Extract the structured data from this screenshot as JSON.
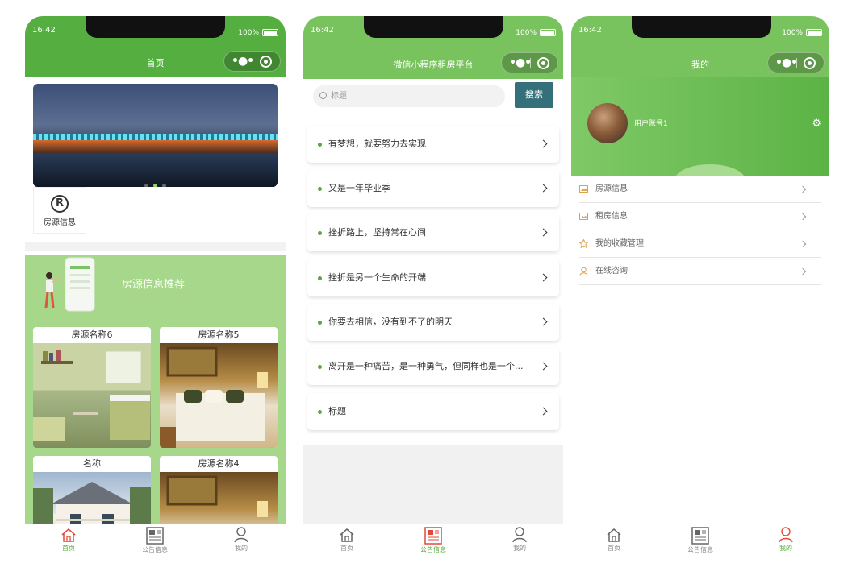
{
  "status": {
    "time": "16:42",
    "battery": "100%"
  },
  "phone1": {
    "nav_title": "首页",
    "category": {
      "label": "房源信息"
    },
    "recommend_title": "房源信息推荐",
    "cards": [
      {
        "title": "房源名称6"
      },
      {
        "title": "房源名称5"
      },
      {
        "title": "名称"
      },
      {
        "title": "房源名称4"
      }
    ]
  },
  "phone2": {
    "nav_title": "微信小程序租房平台",
    "search": {
      "placeholder": "标题",
      "button": "搜索"
    },
    "notices": [
      "有梦想，就要努力去实现",
      "又是一年毕业季",
      "挫折路上，坚持常在心间",
      "挫折是另一个生命的开端",
      "你要去相信，没有到不了的明天",
      "离开是一种痛苦，是一种勇气，但同样也是一个...",
      "标题"
    ]
  },
  "phone3": {
    "nav_title": "我的",
    "username": "用户账号1",
    "menu": [
      {
        "label": "房源信息",
        "icon": "picture-icon"
      },
      {
        "label": "租房信息",
        "icon": "picture-icon"
      },
      {
        "label": "我的收藏管理",
        "icon": "star-icon"
      },
      {
        "label": "在线咨询",
        "icon": "consult-icon"
      }
    ]
  },
  "tabbar": {
    "home": "首页",
    "notice": "公告信息",
    "mine": "我的"
  },
  "colors": {
    "primary_green": "#54ae40",
    "light_green": "#78c35d",
    "accent_red": "#e04a3a",
    "search_button": "#33707a"
  }
}
